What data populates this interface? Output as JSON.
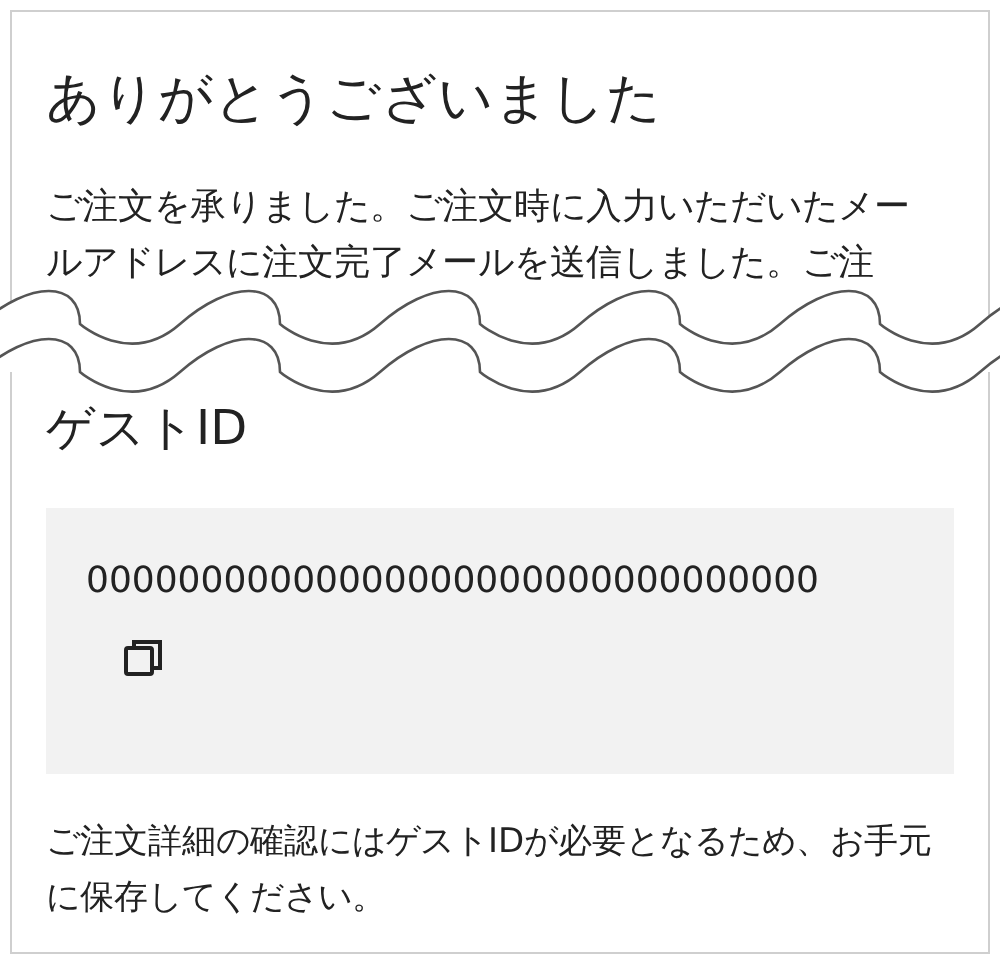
{
  "title": "ありがとうございました",
  "message": "ご注文を承りました。ご注文時に入力いただいたメールアドレスに注文完了メールを送信しました。ご注",
  "guest_id": {
    "heading": "ゲストID",
    "value": "00000000000000000000000000000000"
  },
  "note": "ご注文詳細の確認にはゲストIDが必要となるため、お手元に保存してください。"
}
